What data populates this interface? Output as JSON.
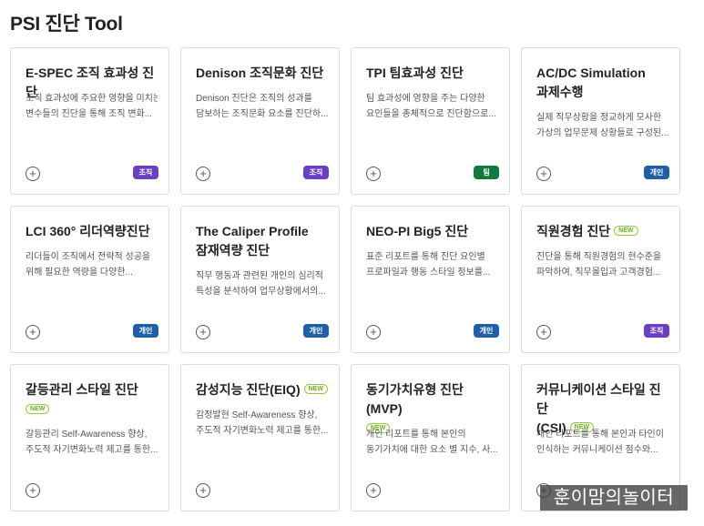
{
  "page": {
    "title": "PSI 진단 Tool"
  },
  "tag_colors": {
    "조직": "#6a3fc4",
    "팀": "#0f7a3c",
    "개인": "#1f5fa8"
  },
  "cards": [
    {
      "title_lines": [
        "E-SPEC 조직 효과성 진단"
      ],
      "new": false,
      "desc_lines": [
        "조직 효과성에 주요한 영향을 미치는",
        "변수들의 진단을 통해 조직 변화..."
      ],
      "tag": "조직",
      "add_icon": "+"
    },
    {
      "title_lines": [
        "Denison 조직문화 진단"
      ],
      "new": false,
      "desc_lines": [
        "Denison 진단은 조직의 성과를",
        "담보하는 조직문화 요소를 진단하..."
      ],
      "tag": "조직",
      "add_icon": "+"
    },
    {
      "title_lines": [
        "TPI 팀효과성 진단"
      ],
      "new": false,
      "desc_lines": [
        "팀 효과성에 영향을 주는 다양한",
        "요인들을 총체적으로 진단함으로..."
      ],
      "tag": "팀",
      "add_icon": "+"
    },
    {
      "title_lines": [
        "AC/DC Simulation",
        "과제수행"
      ],
      "new": false,
      "desc_lines": [
        "실제 직무상황을 정교하게 모사한",
        "가상의 업무문제 상황들로 구성된..."
      ],
      "tag": "개인",
      "add_icon": "+"
    },
    {
      "title_lines": [
        "LCI 360° 리더역량진단"
      ],
      "new": false,
      "desc_lines": [
        "리더들이 조직에서 전략적 성공을",
        "위해 필요한 역량을 다양한..."
      ],
      "tag": "개인",
      "add_icon": "+"
    },
    {
      "title_lines": [
        "The Caliper Profile",
        "잠재역량 진단"
      ],
      "new": false,
      "desc_lines": [
        "직무 행동과 관련된 개인의 심리적",
        "특성을 분석하여 업무상황에서의..."
      ],
      "tag": "개인",
      "add_icon": "+"
    },
    {
      "title_lines": [
        "NEO-PI Big5 진단"
      ],
      "new": false,
      "desc_lines": [
        "표준 리포트를 통해 진단 요인별",
        "프로파일과 행동 스타일 정보를..."
      ],
      "tag": "개인",
      "add_icon": "+"
    },
    {
      "title_lines": [
        "직원경험 진단"
      ],
      "new": true,
      "new_inline": true,
      "desc_lines": [
        "진단을 통해 직원경험의 현수준을",
        "파악하여, 직무몰입과 고객경험..."
      ],
      "tag": "조직",
      "add_icon": "+"
    },
    {
      "title_lines": [
        "갈등관리 스타일 진단"
      ],
      "new": true,
      "new_inline": false,
      "desc_lines": [
        "갈등관리 Self-Awareness 향상,",
        "주도적 자기변화노력 제고를 통한..."
      ],
      "tag": "",
      "add_icon": "+"
    },
    {
      "title_lines": [
        "감성지능 진단(EIQ)"
      ],
      "new": true,
      "new_inline": true,
      "desc_lines": [
        "감정발현 Self-Awareness 향상,",
        "주도적 자기변화노력 제고를 통한..."
      ],
      "tag": "",
      "add_icon": "+"
    },
    {
      "title_lines": [
        "동기가치유형 진단(MVP)"
      ],
      "new": true,
      "new_inline": false,
      "desc_lines": [
        "개인 리포트를 통해 본인의",
        "동기가치에 대한 요소 별 지수, 사..."
      ],
      "tag": "",
      "add_icon": "+"
    },
    {
      "title_lines": [
        "커뮤니케이션 스타일 진단",
        "(CSI)"
      ],
      "new": true,
      "new_inline": true,
      "desc_lines": [
        "개인 리포트를 통해 본인과 타인이",
        "인식하는 커뮤니케이션 점수와..."
      ],
      "tag": "",
      "add_icon": "+"
    }
  ],
  "new_label": "NEW",
  "watermark": "훈이맘의놀이터"
}
